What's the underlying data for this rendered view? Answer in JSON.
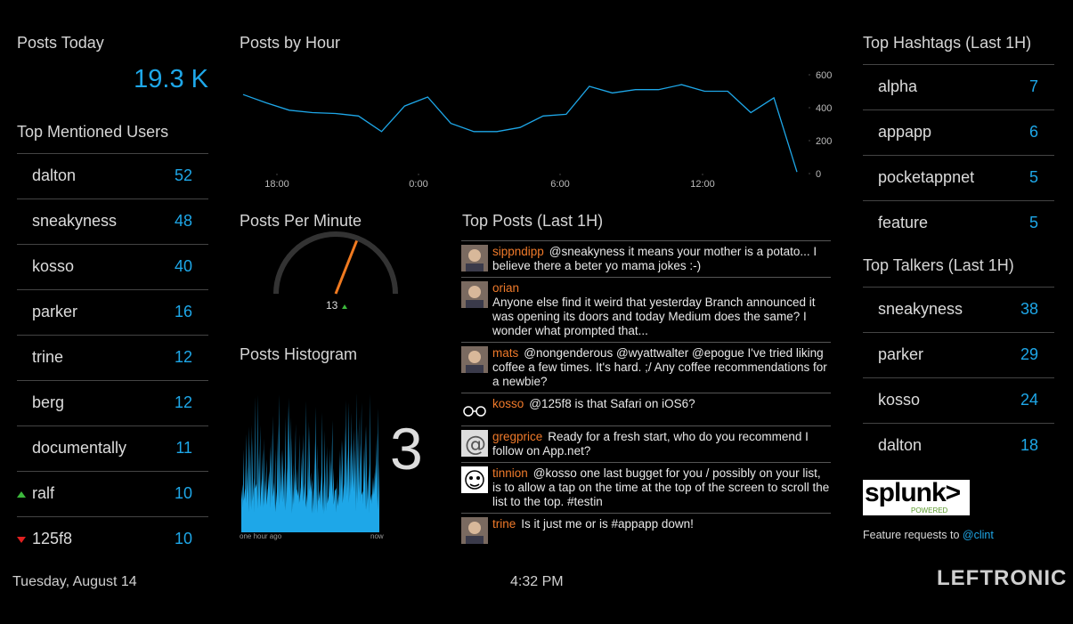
{
  "posts_today": {
    "title": "Posts Today",
    "value": "19.3 K"
  },
  "top_mentioned": {
    "title": "Top Mentioned Users",
    "items": [
      {
        "name": "dalton",
        "count": "52"
      },
      {
        "name": "sneakyness",
        "count": "48"
      },
      {
        "name": "kosso",
        "count": "40"
      },
      {
        "name": "parker",
        "count": "16"
      },
      {
        "name": "trine",
        "count": "12"
      },
      {
        "name": "berg",
        "count": "12"
      },
      {
        "name": "documentally",
        "count": "11"
      },
      {
        "name": "ralf",
        "count": "10",
        "trend": "up"
      },
      {
        "name": "125f8",
        "count": "10",
        "trend": "down"
      }
    ]
  },
  "posts_by_hour": {
    "title": "Posts by Hour",
    "chart_data": {
      "type": "line",
      "x_labels": [
        "18:00",
        "0:00",
        "6:00",
        "12:00"
      ],
      "y_ticks": [
        "600",
        "400",
        "200",
        "0"
      ],
      "ylim": [
        0,
        600
      ],
      "values": [
        480,
        430,
        385,
        370,
        365,
        350,
        255,
        410,
        465,
        305,
        255,
        255,
        280,
        350,
        360,
        530,
        490,
        510,
        510,
        540,
        500,
        500,
        370,
        460,
        10
      ],
      "line_color": "#1ea7e8"
    }
  },
  "posts_per_minute": {
    "title": "Posts Per Minute",
    "value": "13",
    "gauge_fraction": 0.62
  },
  "histogram": {
    "title": "Posts Histogram",
    "current": "3",
    "start_label": "one hour ago",
    "end_label": "now"
  },
  "top_posts": {
    "title": "Top Posts (Last 1H)",
    "items": [
      {
        "user": "sippndipp",
        "text": "@sneakyness it means your mother is a potato... I believe there a beter yo mama jokes :-)",
        "avatar": "person-avatar-icon"
      },
      {
        "user": "orian",
        "text": "Anyone else find it weird that yesterday Branch announced it was opening its doors and today Medium does the same? I wonder what prompted that...",
        "avatar": "person-avatar-icon"
      },
      {
        "user": "mats",
        "text": "@nongenderous @wyattwalter @epogue I've tried liking coffee a few times. It's hard. ;/ Any coffee recommendations for a newbie?",
        "avatar": "person-avatar-icon"
      },
      {
        "user": "kosso",
        "text": "@125f8 is that Safari on iOS6?",
        "avatar": "glasses-avatar-icon"
      },
      {
        "user": "gregprice",
        "text": "Ready for a fresh start, who do you recommend I follow on App.net?",
        "avatar": "at-sign-avatar-icon"
      },
      {
        "user": "tinnion",
        "text": "@kosso one last bugget for you / possibly on your list, is to allow a tap on the time at the top of the screen to scroll the list to the top. #testin",
        "avatar": "cartoon-avatar-icon"
      },
      {
        "user": "trine",
        "text": "Is it just me or is #appapp down!",
        "avatar": "person-avatar-icon"
      }
    ]
  },
  "top_hashtags": {
    "title": "Top Hashtags (Last 1H)",
    "items": [
      {
        "name": "alpha",
        "count": "7"
      },
      {
        "name": "appapp",
        "count": "6"
      },
      {
        "name": "pocketappnet",
        "count": "5"
      },
      {
        "name": "feature",
        "count": "5"
      }
    ]
  },
  "top_talkers": {
    "title": "Top Talkers (Last 1H)",
    "items": [
      {
        "name": "sneakyness",
        "count": "38"
      },
      {
        "name": "parker",
        "count": "29"
      },
      {
        "name": "kosso",
        "count": "24"
      },
      {
        "name": "dalton",
        "count": "18"
      }
    ]
  },
  "splunk_logo": {
    "text": "splunk>",
    "sub": "POWERED"
  },
  "feature_requests": {
    "text": "Feature requests to",
    "link": "@clint"
  },
  "footer": {
    "date": "Tuesday, August 14",
    "time": "4:32 PM",
    "brand": "LEFTRONIC"
  }
}
